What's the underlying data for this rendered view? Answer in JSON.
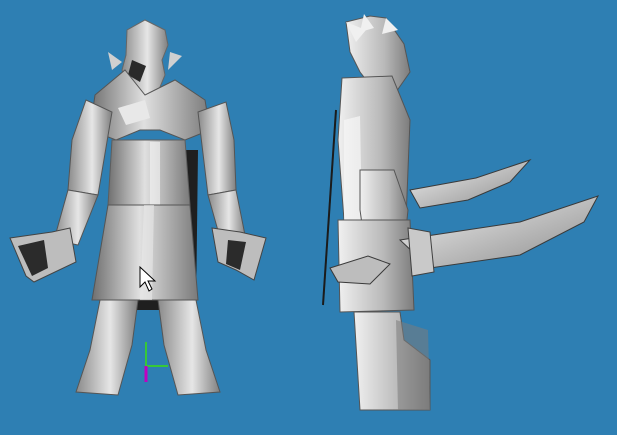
{
  "viewport": {
    "background": "#2e7fb3",
    "model_front_label": "",
    "model_side_label": ""
  },
  "colors": {
    "mesh_light": "#d8d8d8",
    "mesh_mid": "#a8a8a8",
    "mesh_dark": "#6f6f6f",
    "mesh_shadow": "#2c2c2c",
    "axis_green": "#37c837",
    "axis_blue": "#3a78ff",
    "axis_magenta": "#c000c0",
    "cursor_fill": "#ffffff",
    "cursor_stroke": "#000000"
  },
  "icons": {
    "cursor": "arrow-cursor-icon",
    "axes": "xyz-axes-gizmo-icon"
  }
}
